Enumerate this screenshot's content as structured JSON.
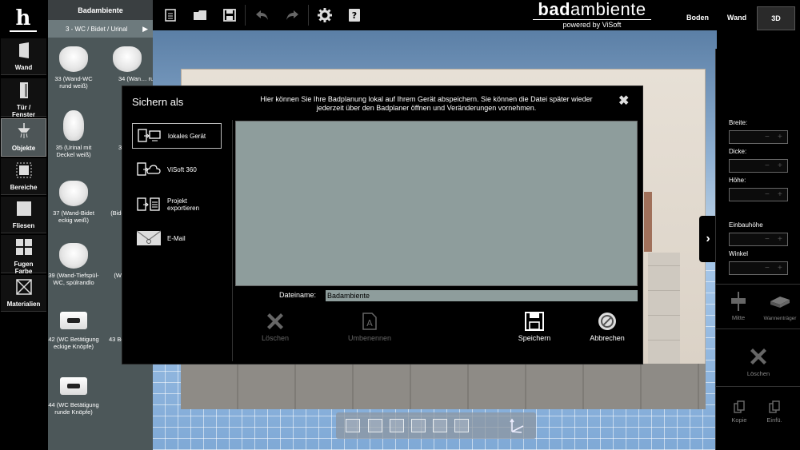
{
  "topbar": {
    "logo_icon": "h-logo-icon",
    "buttons": [
      {
        "name": "new-doc",
        "icon": "doc-icon"
      },
      {
        "name": "open",
        "icon": "folder-icon"
      },
      {
        "name": "save",
        "icon": "floppy-icon"
      },
      {
        "name": "undo",
        "icon": "undo-icon"
      },
      {
        "name": "redo",
        "icon": "redo-icon"
      },
      {
        "name": "settings",
        "icon": "gear-icon"
      },
      {
        "name": "help",
        "icon": "help-icon"
      }
    ],
    "brand_part1": "bad",
    "brand_part2": "ambiente",
    "brand_sub": "powered by ViSoft",
    "views": [
      "Boden",
      "Wand",
      "3D"
    ],
    "active_view": "3D"
  },
  "left_tools": [
    {
      "label": "Wand"
    },
    {
      "label": "Tür /\nFenster"
    },
    {
      "label": "Objekte"
    },
    {
      "label": "Bereiche"
    },
    {
      "label": "Fliesen"
    },
    {
      "label": "Fugen\nFarbe"
    },
    {
      "label": "Materialien"
    }
  ],
  "catalog": {
    "header": "Badambiente",
    "subcategory": "3 - WC / Bidet / Urinal",
    "items": [
      {
        "label": "33 (Wand-WC rund weiß)",
        "type": "toilet"
      },
      {
        "label": "34 (Wan… run…",
        "type": "toilet"
      },
      {
        "label": "35 (Urinal mit Deckel weiß)",
        "type": "urinal"
      },
      {
        "label": "36 (W… eckig…",
        "type": "urinal"
      },
      {
        "label": "37 (Wand-Bidet eckig weiß)",
        "type": "toilet"
      },
      {
        "label": "(Bidet… ch…",
        "type": "toilet"
      },
      {
        "label": "39 (Wand-Tiefspül-WC, spülrandlo",
        "type": "toilet"
      },
      {
        "label": "(Wan… w…",
        "type": "toilet"
      },
      {
        "label": "42 (WC Betätigung eckige Knöpfe)",
        "type": "flush"
      },
      {
        "label": "43 Betä… fläche…",
        "type": "flush"
      },
      {
        "label": "44 (WC Betätigung runde Knöpfe)",
        "type": "flush"
      }
    ]
  },
  "right_panel": {
    "fields": [
      {
        "label": "Breite:"
      },
      {
        "label": "Dicke:"
      },
      {
        "label": "Höhe:"
      },
      {
        "label": "Einbauhöhe"
      },
      {
        "label": "Winkel"
      }
    ],
    "tools": [
      {
        "label": "Mitte"
      },
      {
        "label": "Wannenträger"
      }
    ],
    "delete_label": "Löschen",
    "copy_label": "Kopie",
    "paste_label": "Einfü."
  },
  "dialog": {
    "title": "Sichern als",
    "info": "Hier können Sie Ihre Badplanung lokal auf Ihrem Gerät abspeichern. Sie können die Datei später wieder jederzeit über den Badplaner öffnen und Veränderungen vornehmen.",
    "options": [
      {
        "label": "lokales Gerät",
        "icon": "local-device-icon"
      },
      {
        "label": "ViSoft 360",
        "icon": "cloud-icon"
      },
      {
        "label": "Projekt\nexportieren",
        "icon": "export-icon"
      },
      {
        "label": "E-Mail",
        "icon": "email-icon"
      }
    ],
    "active_option": "lokales Gerät",
    "filename_label": "Dateiname:",
    "filename_value": "Badambiente",
    "actions": [
      {
        "label": "Löschen",
        "enabled": false
      },
      {
        "label": "Umbenennen",
        "enabled": false
      },
      {
        "label": "Speichern",
        "enabled": true
      },
      {
        "label": "Abbrechen",
        "enabled": true
      }
    ]
  },
  "colors": {
    "panel": "#4c5759",
    "preview": "#8e9d9c",
    "active_tool": "#4d5557"
  }
}
